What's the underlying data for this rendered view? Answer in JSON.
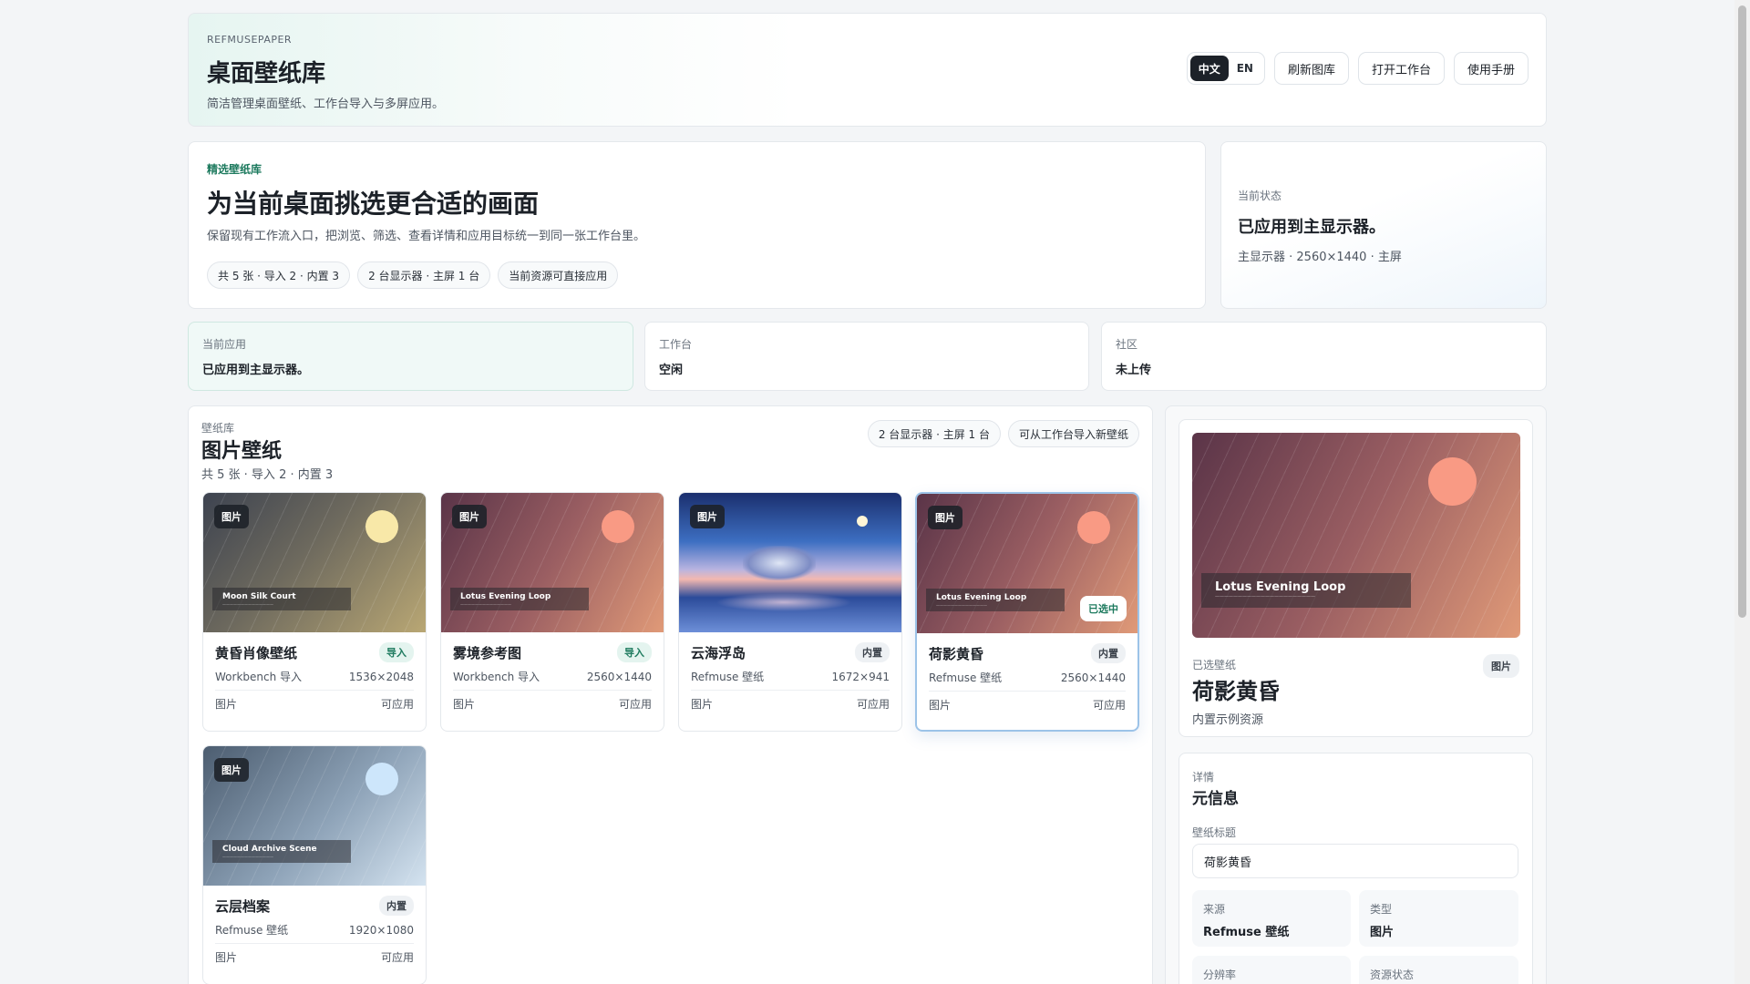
{
  "header": {
    "brand": "REFMUSEPAPER",
    "title": "桌面壁纸库",
    "subtitle": "简洁管理桌面壁纸、工作台导入与多屏应用。",
    "lang_zh": "中文",
    "lang_en": "EN",
    "refresh_label": "刷新图库",
    "open_workbench_label": "打开工作台",
    "manual_label": "使用手册"
  },
  "hero": {
    "eyebrow": "精选壁纸库",
    "title": "为当前桌面挑选更合适的画面",
    "description": "保留现有工作流入口，把浏览、筛选、查看详情和应用目标统一到同一张工作台里。",
    "pills": [
      "共 5 张 · 导入 2 · 内置 3",
      "2 台显示器 · 主屏 1 台",
      "当前资源可直接应用"
    ]
  },
  "status_card": {
    "label": "当前状态",
    "value": "已应用到主显示器。",
    "detail": "主显示器 · 2560×1440 · 主屏"
  },
  "stats": [
    {
      "label": "当前应用",
      "value": "已应用到主显示器。"
    },
    {
      "label": "工作台",
      "value": "空闲"
    },
    {
      "label": "社区",
      "value": "未上传"
    }
  ],
  "library": {
    "eyebrow": "壁纸库",
    "title": "图片壁纸",
    "summary": "共 5 张 · 导入 2 · 内置 3",
    "pill_monitors": "2 台显示器 · 主屏 1 台",
    "pill_import": "可从工作台导入新壁纸",
    "selected_label": "已选中",
    "items": [
      {
        "badge": "图片",
        "caption": "Moon Silk Court",
        "title": "黄昏肖像壁纸",
        "tag": "导入",
        "tag_type": "import",
        "source": "Workbench 导入",
        "resolution": "1536×2048",
        "type": "图片",
        "status": "可应用"
      },
      {
        "badge": "图片",
        "caption": "Lotus Evening Loop",
        "title": "雾境参考图",
        "tag": "导入",
        "tag_type": "import",
        "source": "Workbench 导入",
        "resolution": "2560×1440",
        "type": "图片",
        "status": "可应用"
      },
      {
        "badge": "图片",
        "caption": "",
        "title": "云海浮岛",
        "tag": "内置",
        "tag_type": "builtin",
        "source": "Refmuse 壁纸",
        "resolution": "1672×941",
        "type": "图片",
        "status": "可应用"
      },
      {
        "badge": "图片",
        "caption": "Lotus Evening Loop",
        "title": "荷影黄昏",
        "tag": "内置",
        "tag_type": "builtin",
        "source": "Refmuse 壁纸",
        "resolution": "2560×1440",
        "type": "图片",
        "status": "可应用"
      },
      {
        "badge": "图片",
        "caption": "Cloud Archive Scene",
        "title": "云层档案",
        "tag": "内置",
        "tag_type": "builtin",
        "source": "Refmuse 壁纸",
        "resolution": "1920×1080",
        "type": "图片",
        "status": "可应用"
      }
    ]
  },
  "detail": {
    "preview_caption": "Lotus Evening Loop",
    "selected_label": "已选壁纸",
    "type_badge": "图片",
    "title": "荷影黄昏",
    "subtitle": "内置示例资源",
    "meta_eyebrow": "详情",
    "meta_title": "元信息",
    "field_label": "壁纸标题",
    "field_value": "荷影黄昏",
    "source_label": "来源",
    "source_value": "Refmuse 壁纸",
    "type_label": "类型",
    "type_value": "图片",
    "resolution_label": "分辨率",
    "asset_status_label": "资源状态"
  },
  "colors": {
    "accent_green": "#1d7a5e",
    "selected_border": "#9cc3e8",
    "dark": "#1c2128"
  }
}
